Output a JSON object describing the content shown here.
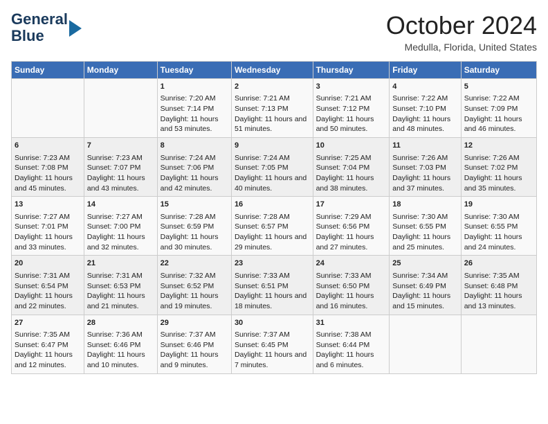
{
  "header": {
    "logo_line1": "General",
    "logo_line2": "Blue",
    "month": "October 2024",
    "location": "Medulla, Florida, United States"
  },
  "days_of_week": [
    "Sunday",
    "Monday",
    "Tuesday",
    "Wednesday",
    "Thursday",
    "Friday",
    "Saturday"
  ],
  "weeks": [
    [
      {
        "day": "",
        "sunrise": "",
        "sunset": "",
        "daylight": ""
      },
      {
        "day": "",
        "sunrise": "",
        "sunset": "",
        "daylight": ""
      },
      {
        "day": "1",
        "sunrise": "Sunrise: 7:20 AM",
        "sunset": "Sunset: 7:14 PM",
        "daylight": "Daylight: 11 hours and 53 minutes."
      },
      {
        "day": "2",
        "sunrise": "Sunrise: 7:21 AM",
        "sunset": "Sunset: 7:13 PM",
        "daylight": "Daylight: 11 hours and 51 minutes."
      },
      {
        "day": "3",
        "sunrise": "Sunrise: 7:21 AM",
        "sunset": "Sunset: 7:12 PM",
        "daylight": "Daylight: 11 hours and 50 minutes."
      },
      {
        "day": "4",
        "sunrise": "Sunrise: 7:22 AM",
        "sunset": "Sunset: 7:10 PM",
        "daylight": "Daylight: 11 hours and 48 minutes."
      },
      {
        "day": "5",
        "sunrise": "Sunrise: 7:22 AM",
        "sunset": "Sunset: 7:09 PM",
        "daylight": "Daylight: 11 hours and 46 minutes."
      }
    ],
    [
      {
        "day": "6",
        "sunrise": "Sunrise: 7:23 AM",
        "sunset": "Sunset: 7:08 PM",
        "daylight": "Daylight: 11 hours and 45 minutes."
      },
      {
        "day": "7",
        "sunrise": "Sunrise: 7:23 AM",
        "sunset": "Sunset: 7:07 PM",
        "daylight": "Daylight: 11 hours and 43 minutes."
      },
      {
        "day": "8",
        "sunrise": "Sunrise: 7:24 AM",
        "sunset": "Sunset: 7:06 PM",
        "daylight": "Daylight: 11 hours and 42 minutes."
      },
      {
        "day": "9",
        "sunrise": "Sunrise: 7:24 AM",
        "sunset": "Sunset: 7:05 PM",
        "daylight": "Daylight: 11 hours and 40 minutes."
      },
      {
        "day": "10",
        "sunrise": "Sunrise: 7:25 AM",
        "sunset": "Sunset: 7:04 PM",
        "daylight": "Daylight: 11 hours and 38 minutes."
      },
      {
        "day": "11",
        "sunrise": "Sunrise: 7:26 AM",
        "sunset": "Sunset: 7:03 PM",
        "daylight": "Daylight: 11 hours and 37 minutes."
      },
      {
        "day": "12",
        "sunrise": "Sunrise: 7:26 AM",
        "sunset": "Sunset: 7:02 PM",
        "daylight": "Daylight: 11 hours and 35 minutes."
      }
    ],
    [
      {
        "day": "13",
        "sunrise": "Sunrise: 7:27 AM",
        "sunset": "Sunset: 7:01 PM",
        "daylight": "Daylight: 11 hours and 33 minutes."
      },
      {
        "day": "14",
        "sunrise": "Sunrise: 7:27 AM",
        "sunset": "Sunset: 7:00 PM",
        "daylight": "Daylight: 11 hours and 32 minutes."
      },
      {
        "day": "15",
        "sunrise": "Sunrise: 7:28 AM",
        "sunset": "Sunset: 6:59 PM",
        "daylight": "Daylight: 11 hours and 30 minutes."
      },
      {
        "day": "16",
        "sunrise": "Sunrise: 7:28 AM",
        "sunset": "Sunset: 6:57 PM",
        "daylight": "Daylight: 11 hours and 29 minutes."
      },
      {
        "day": "17",
        "sunrise": "Sunrise: 7:29 AM",
        "sunset": "Sunset: 6:56 PM",
        "daylight": "Daylight: 11 hours and 27 minutes."
      },
      {
        "day": "18",
        "sunrise": "Sunrise: 7:30 AM",
        "sunset": "Sunset: 6:55 PM",
        "daylight": "Daylight: 11 hours and 25 minutes."
      },
      {
        "day": "19",
        "sunrise": "Sunrise: 7:30 AM",
        "sunset": "Sunset: 6:55 PM",
        "daylight": "Daylight: 11 hours and 24 minutes."
      }
    ],
    [
      {
        "day": "20",
        "sunrise": "Sunrise: 7:31 AM",
        "sunset": "Sunset: 6:54 PM",
        "daylight": "Daylight: 11 hours and 22 minutes."
      },
      {
        "day": "21",
        "sunrise": "Sunrise: 7:31 AM",
        "sunset": "Sunset: 6:53 PM",
        "daylight": "Daylight: 11 hours and 21 minutes."
      },
      {
        "day": "22",
        "sunrise": "Sunrise: 7:32 AM",
        "sunset": "Sunset: 6:52 PM",
        "daylight": "Daylight: 11 hours and 19 minutes."
      },
      {
        "day": "23",
        "sunrise": "Sunrise: 7:33 AM",
        "sunset": "Sunset: 6:51 PM",
        "daylight": "Daylight: 11 hours and 18 minutes."
      },
      {
        "day": "24",
        "sunrise": "Sunrise: 7:33 AM",
        "sunset": "Sunset: 6:50 PM",
        "daylight": "Daylight: 11 hours and 16 minutes."
      },
      {
        "day": "25",
        "sunrise": "Sunrise: 7:34 AM",
        "sunset": "Sunset: 6:49 PM",
        "daylight": "Daylight: 11 hours and 15 minutes."
      },
      {
        "day": "26",
        "sunrise": "Sunrise: 7:35 AM",
        "sunset": "Sunset: 6:48 PM",
        "daylight": "Daylight: 11 hours and 13 minutes."
      }
    ],
    [
      {
        "day": "27",
        "sunrise": "Sunrise: 7:35 AM",
        "sunset": "Sunset: 6:47 PM",
        "daylight": "Daylight: 11 hours and 12 minutes."
      },
      {
        "day": "28",
        "sunrise": "Sunrise: 7:36 AM",
        "sunset": "Sunset: 6:46 PM",
        "daylight": "Daylight: 11 hours and 10 minutes."
      },
      {
        "day": "29",
        "sunrise": "Sunrise: 7:37 AM",
        "sunset": "Sunset: 6:46 PM",
        "daylight": "Daylight: 11 hours and 9 minutes."
      },
      {
        "day": "30",
        "sunrise": "Sunrise: 7:37 AM",
        "sunset": "Sunset: 6:45 PM",
        "daylight": "Daylight: 11 hours and 7 minutes."
      },
      {
        "day": "31",
        "sunrise": "Sunrise: 7:38 AM",
        "sunset": "Sunset: 6:44 PM",
        "daylight": "Daylight: 11 hours and 6 minutes."
      },
      {
        "day": "",
        "sunrise": "",
        "sunset": "",
        "daylight": ""
      },
      {
        "day": "",
        "sunrise": "",
        "sunset": "",
        "daylight": ""
      }
    ]
  ]
}
